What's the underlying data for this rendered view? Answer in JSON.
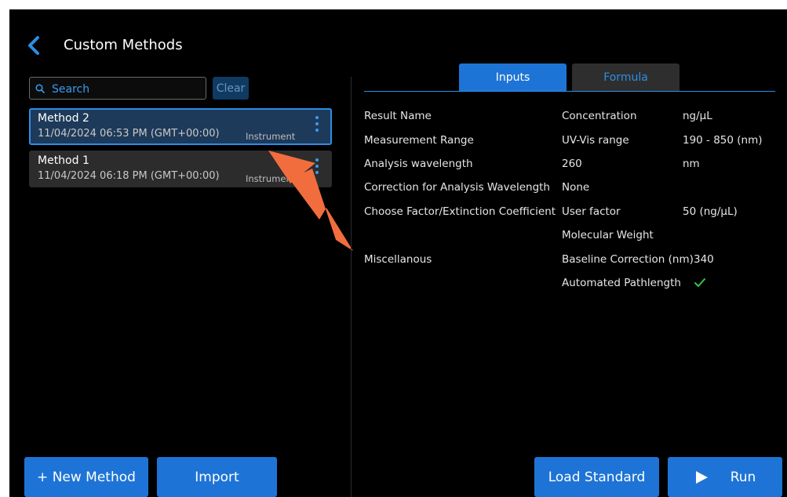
{
  "header": {
    "title": "Custom Methods"
  },
  "search": {
    "placeholder": "Search",
    "clear_label": "Clear"
  },
  "methods": [
    {
      "name": "Method 2",
      "date": "11/04/2024 06:53 PM (GMT+00:00)",
      "source": "Instrument",
      "selected": true
    },
    {
      "name": "Method 1",
      "date": "11/04/2024 06:18 PM (GMT+00:00)",
      "source": "Instrument",
      "selected": false
    }
  ],
  "tabs": [
    {
      "label": "Inputs",
      "active": true
    },
    {
      "label": "Formula",
      "active": false
    }
  ],
  "params": {
    "result_name": {
      "label": "Result Name",
      "value": "Concentration",
      "unit": "ng/µL"
    },
    "measurement_range": {
      "label": "Measurement Range",
      "value": "UV-Vis range",
      "unit": "190 - 850 (nm)"
    },
    "analysis_wavelength": {
      "label": "Analysis wavelength",
      "value": "260",
      "unit": "nm"
    },
    "correction": {
      "label": "Correction for Analysis Wavelength",
      "value": "None"
    },
    "factor": {
      "label": "Choose Factor/Extinction Coefficient",
      "value": "User factor",
      "unit": "50 (ng/µL)",
      "value2": "Molecular Weight"
    },
    "misc": {
      "label": "Miscellanous",
      "baseline_label": "Baseline Correction (nm)",
      "baseline_value": "340",
      "pathlength_label": "Automated Pathlength",
      "pathlength_enabled": true
    }
  },
  "buttons": {
    "new_method": "+ New Method",
    "import": "Import",
    "load_standard": "Load Standard",
    "run": "Run"
  },
  "colors": {
    "accent": "#1e74d6",
    "selected_bg": "#1e3a5a",
    "check": "#3cc14a",
    "annotation_arrow": "#f26d3d"
  },
  "icons": {
    "back": "chevron-left-icon",
    "search": "search-icon",
    "more": "kebab-menu-icon",
    "check": "check-icon",
    "run": "play-icon"
  }
}
